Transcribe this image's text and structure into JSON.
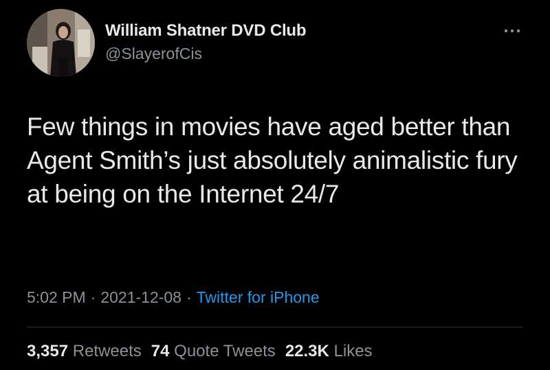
{
  "author": {
    "display_name": "William Shatner DVD Club",
    "handle": "@SlayerofCis",
    "avatar_icon": "profile-photo"
  },
  "more_icon": "more-options-icon",
  "tweet": {
    "text": "Few things in movies have aged better than Agent Smith’s just absolutely animalistic fury at being on the Internet 24/7",
    "time": "5:02 PM",
    "date": "2021-12-08",
    "separator": "·",
    "source": "Twitter for iPhone"
  },
  "stats": {
    "retweets_count": "3,357",
    "retweets_label": "Retweets",
    "quotes_count": "74",
    "quotes_label": "Quote Tweets",
    "likes_count": "22.3K",
    "likes_label": "Likes"
  },
  "colors": {
    "background": "#000000",
    "text": "#e7e9ea",
    "secondary": "#8b9299",
    "link": "#1d9bf0",
    "divider": "#2f3336"
  }
}
